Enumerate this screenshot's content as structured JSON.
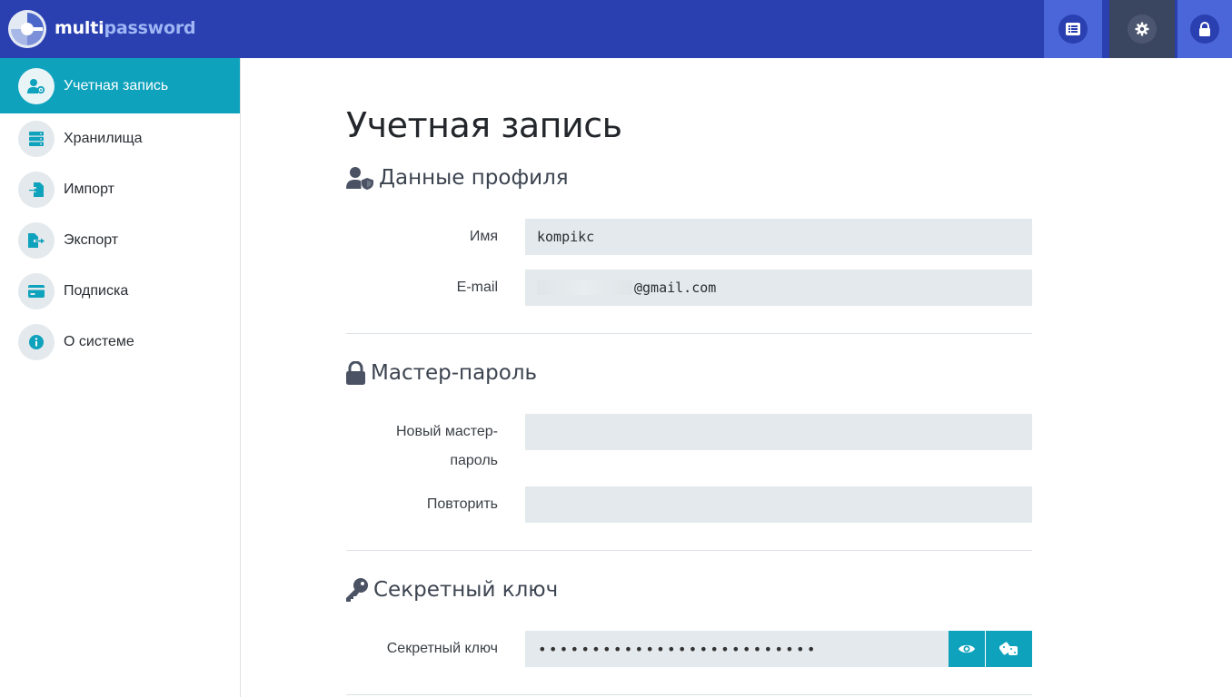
{
  "header": {
    "brand_part1": "multi",
    "brand_part2": "password",
    "buttons": [
      {
        "name": "list-icon"
      },
      {
        "name": "gear-icon"
      },
      {
        "name": "lock-icon"
      }
    ]
  },
  "sidebar": {
    "items": [
      {
        "label": "Учетная запись",
        "icon": "user-gear-icon",
        "active": true
      },
      {
        "label": "Хранилища",
        "icon": "server-icon"
      },
      {
        "label": "Импорт",
        "icon": "import-icon"
      },
      {
        "label": "Экспорт",
        "icon": "export-icon"
      },
      {
        "label": "Подписка",
        "icon": "credit-card-icon"
      },
      {
        "label": "О системе",
        "icon": "info-icon"
      }
    ]
  },
  "main": {
    "title": "Учетная запись",
    "profile": {
      "heading": "Данные профиля",
      "name_label": "Имя",
      "name_value": "kompikc",
      "email_label": "E-mail",
      "email_value": "@gmail.com"
    },
    "master": {
      "heading": "Мастер-пароль",
      "new_label_1": "Новый мастер-",
      "new_label_2": "пароль",
      "repeat_label": "Повторить"
    },
    "secret": {
      "heading": "Секретный ключ",
      "key_label": "Секретный ключ",
      "key_value": "••••••••••••••••••••••••••"
    }
  },
  "colors": {
    "header": "#2a3fb0",
    "accent": "#0ea2bc",
    "field": "#e3e9ec"
  }
}
